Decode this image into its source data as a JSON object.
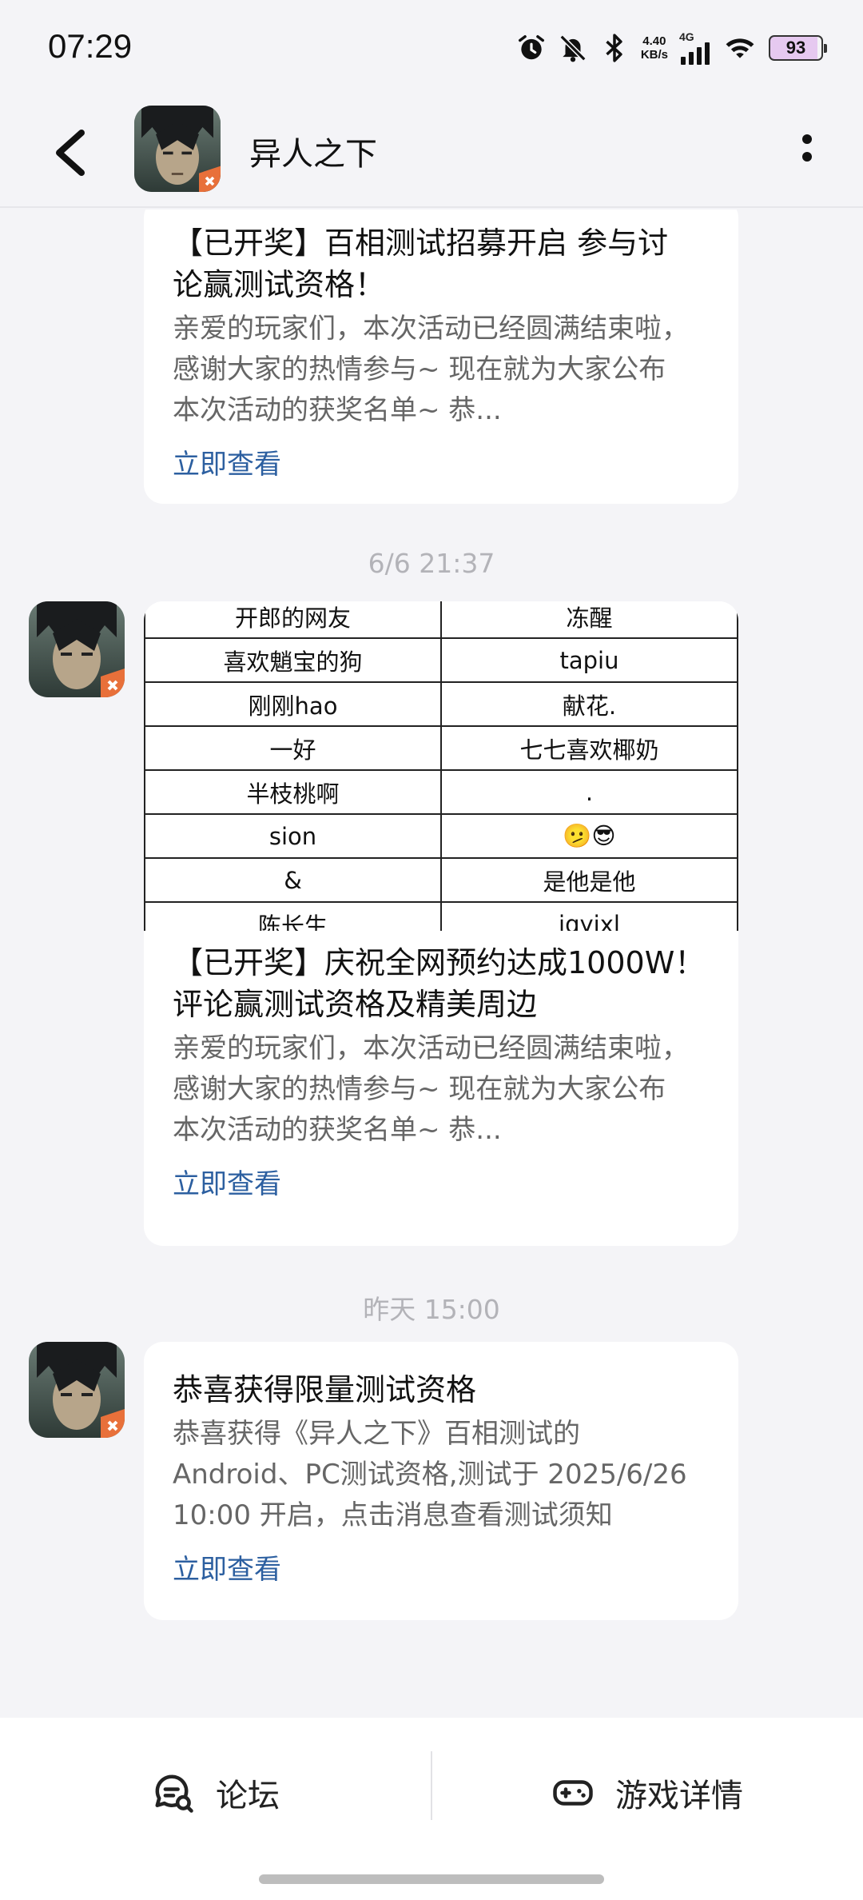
{
  "status_bar": {
    "time": "07:29",
    "net_speed_value": "4.40",
    "net_speed_unit": "KB/s",
    "network": "4G",
    "battery": "93"
  },
  "header": {
    "title": "异人之下"
  },
  "messages": [
    {
      "title_line1": "【已开奖】百相测试招募开启 参与讨",
      "title_line2": "论赢测试资格！",
      "body_line1": "亲爱的玩家们，本次活动已经圆满结束啦，",
      "body_line2": "感谢大家的热情参与~ 现在就为大家公布",
      "body_line3": "本次活动的获奖名单~ 恭...",
      "link": "立即查看"
    },
    {
      "timestamp": "6/6  21:37",
      "winners": [
        [
          "开郎的网友",
          "冻醒"
        ],
        [
          "喜欢魈宝的狗",
          "tapiu"
        ],
        [
          "刚刚hao",
          "献花."
        ],
        [
          "一好",
          "七七喜欢椰奶"
        ],
        [
          "半枝桃啊",
          "."
        ],
        [
          "sion",
          "🫤😎"
        ],
        [
          "&",
          "是他是他"
        ],
        [
          "陈长生",
          "jqyixl"
        ]
      ],
      "title_line1": "【已开奖】庆祝全网预约达成1000W！",
      "title_line2": "评论赢测试资格及精美周边",
      "body_line1": "亲爱的玩家们，本次活动已经圆满结束啦，",
      "body_line2": "感谢大家的热情参与~ 现在就为大家公布",
      "body_line3": "本次活动的获奖名单~ 恭...",
      "link": "立即查看"
    },
    {
      "timestamp": "昨天  15:00",
      "title_line1": "恭喜获得限量测试资格",
      "body_line1": "恭喜获得《异人之下》百相测试的",
      "body_line2": "Android、PC测试资格,测试于 2025/6/26",
      "body_line3": "10:00 开启，点击消息查看测试须知",
      "link": "立即查看"
    }
  ],
  "bottom_nav": {
    "forum": "论坛",
    "game_details": "游戏详情"
  },
  "colors": {
    "background": "#f4f4f7",
    "card": "#ffffff",
    "link": "#2c5fa0",
    "timestamp": "#b3b3b8"
  },
  "icons": [
    "back-arrow-icon",
    "more-vert-icon",
    "forum-icon",
    "gamepad-icon",
    "alarm-icon",
    "mute-bell-icon",
    "bluetooth-icon",
    "signal-icon",
    "wifi-icon",
    "battery-icon"
  ]
}
